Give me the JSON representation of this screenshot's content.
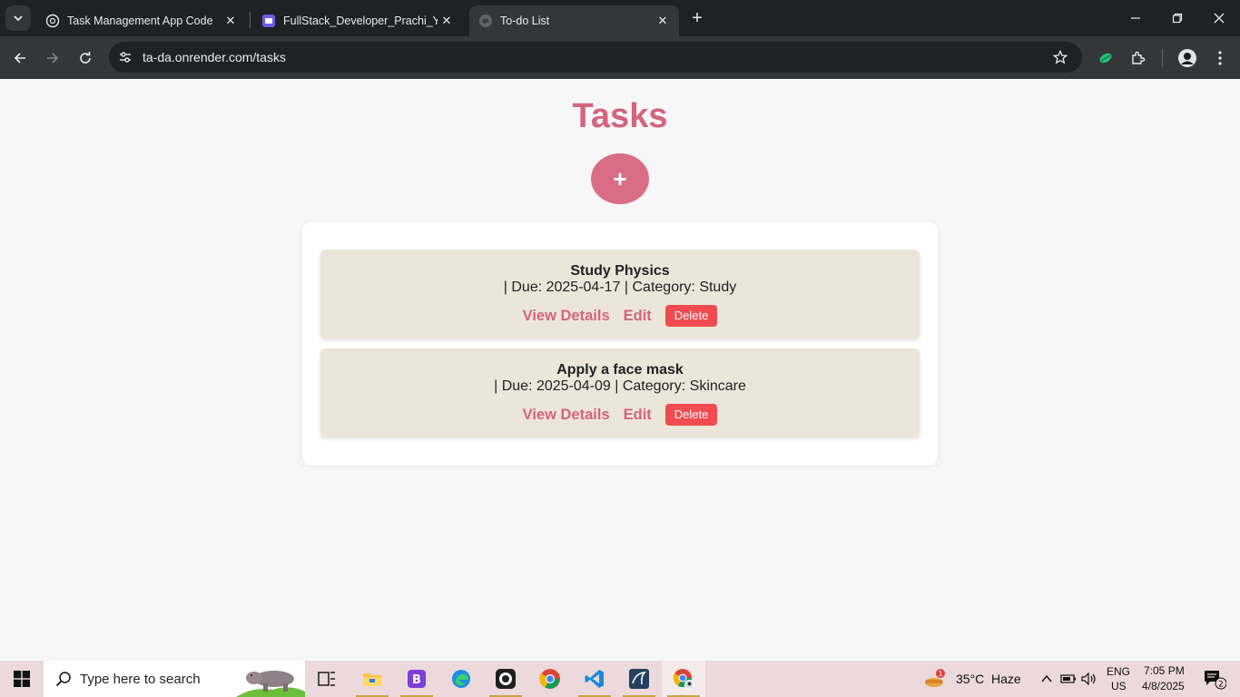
{
  "browser": {
    "tabs": [
      {
        "title": "Task Management App Code",
        "icon": "openai-icon"
      },
      {
        "title": "FullStack_Developer_Prachi_Yadav",
        "icon": "document-icon"
      },
      {
        "title": "To-do List",
        "icon": "globe-icon",
        "active": true
      }
    ],
    "url": "ta-da.onrender.com/tasks"
  },
  "page": {
    "title": "Tasks",
    "add_label": "+",
    "tasks": [
      {
        "name": "Study Physics",
        "meta": "| Due: 2025-04-17 | Category: Study",
        "view_label": "View Details",
        "edit_label": "Edit",
        "delete_label": "Delete"
      },
      {
        "name": "Apply a face mask",
        "meta": "| Due: 2025-04-09 | Category: Skincare",
        "view_label": "View Details",
        "edit_label": "Edit",
        "delete_label": "Delete"
      }
    ]
  },
  "colors": {
    "accent": "#d4647f",
    "card_bg": "#ece6da",
    "delete": "#f04b50"
  },
  "taskbar": {
    "search_placeholder": "Type here to search",
    "weather_temp": "35°C",
    "weather_desc": "Haze",
    "weather_badge": "1",
    "lang": "ENG",
    "region": "US",
    "time": "7:05 PM",
    "date": "4/8/2025",
    "notifications": "2"
  }
}
